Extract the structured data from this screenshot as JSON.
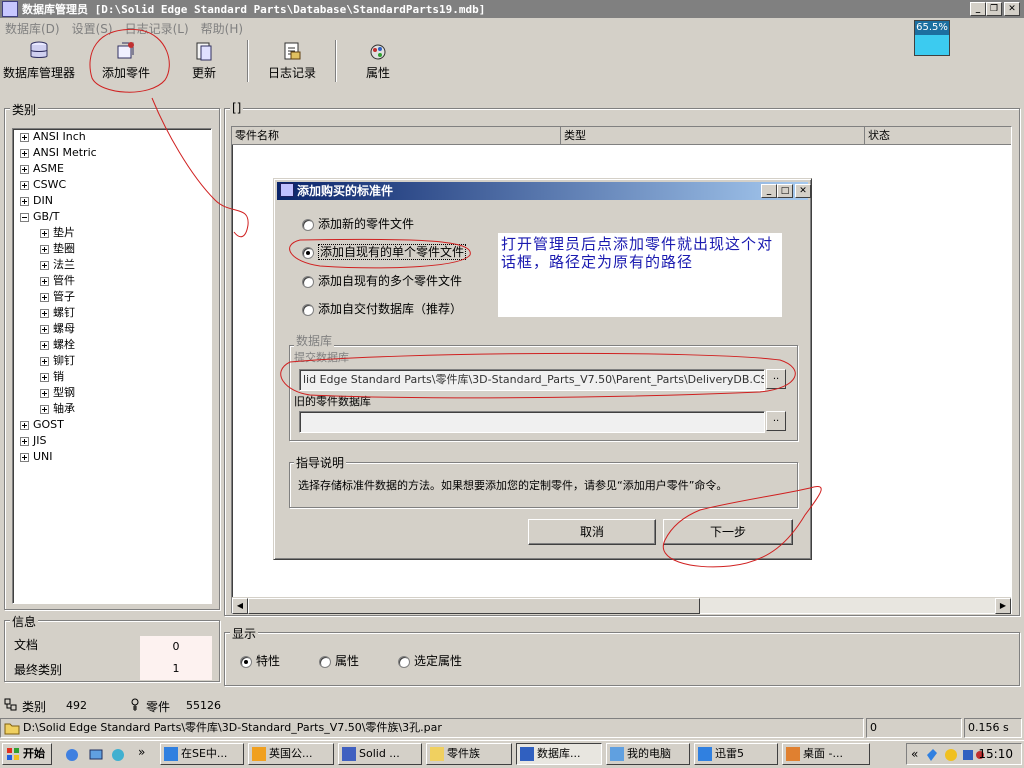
{
  "window": {
    "title": "数据库管理员 [D:\\Solid Edge Standard Parts\\Database\\StandardParts19.mdb]",
    "controls": [
      "_",
      "❐",
      "✕"
    ]
  },
  "menu": [
    "数据库(D)",
    "设置(S)",
    "日志记录(L)",
    "帮助(H)"
  ],
  "toolbar": {
    "db_manager": "数据库管理器",
    "add_part": "添加零件",
    "update": "更新",
    "log": "日志记录",
    "properties": "属性"
  },
  "progress": {
    "label": "65.5%",
    "value": 65.5
  },
  "category": {
    "label": "类别",
    "tree": [
      {
        "label": "ANSI Inch",
        "expanded": false,
        "level": 0
      },
      {
        "label": "ANSI Metric",
        "expanded": false,
        "level": 0
      },
      {
        "label": "ASME",
        "expanded": false,
        "level": 0
      },
      {
        "label": "CSWC",
        "expanded": false,
        "level": 0
      },
      {
        "label": "DIN",
        "expanded": false,
        "level": 0
      },
      {
        "label": "GB/T",
        "expanded": true,
        "level": 0
      },
      {
        "label": "垫片",
        "expanded": false,
        "level": 1
      },
      {
        "label": "垫圈",
        "expanded": false,
        "level": 1
      },
      {
        "label": "法兰",
        "expanded": false,
        "level": 1
      },
      {
        "label": "管件",
        "expanded": false,
        "level": 1
      },
      {
        "label": "管子",
        "expanded": false,
        "level": 1
      },
      {
        "label": "螺钉",
        "expanded": false,
        "level": 1
      },
      {
        "label": "螺母",
        "expanded": false,
        "level": 1
      },
      {
        "label": "螺栓",
        "expanded": false,
        "level": 1
      },
      {
        "label": "铆钉",
        "expanded": false,
        "level": 1
      },
      {
        "label": "销",
        "expanded": false,
        "level": 1
      },
      {
        "label": "型钢",
        "expanded": false,
        "level": 1
      },
      {
        "label": "轴承",
        "expanded": false,
        "level": 1
      },
      {
        "label": "GOST",
        "expanded": false,
        "level": 0
      },
      {
        "label": "JIS",
        "expanded": false,
        "level": 0
      },
      {
        "label": "UNI",
        "expanded": false,
        "level": 0
      }
    ]
  },
  "parts_list": {
    "label": "[]",
    "columns": [
      "零件名称",
      "类型",
      "状态"
    ]
  },
  "info": {
    "label": "信息",
    "doc_label": "文档",
    "doc_value": "0",
    "final_category_label": "最终类别",
    "final_category_value": "1"
  },
  "display": {
    "label": "显示",
    "options": [
      "特性",
      "属性",
      "选定属性"
    ],
    "selected": "特性"
  },
  "status": {
    "category_label": "类别",
    "category_count": "492",
    "part_label": "零件",
    "part_count": "55126",
    "path": "D:\\Solid Edge Standard Parts\\零件库\\3D-Standard_Parts_V7.50\\零件族\\3孔.par",
    "field2": "0",
    "time": "0.156 s"
  },
  "dialog": {
    "title": "添加购买的标准件",
    "options": [
      "添加新的零件文件",
      "添加自现有的单个零件文件",
      "添加自现有的多个零件文件",
      "添加自交付数据库（推荐）"
    ],
    "selected_option": "添加自现有的单个零件文件",
    "note": "打开管理员后点添加零件就出现这个对话框，路径定为原有的路径",
    "database_group": "数据库",
    "submit_db_label": "提交数据库",
    "submit_db_value": "lid Edge Standard Parts\\零件库\\3D-Standard_Parts_V7.50\\Parent_Parts\\DeliveryDB.CS.PL.ddb",
    "old_db_label": "旧的零件数据库",
    "old_db_value": "",
    "browse": "..",
    "guide_group": "指导说明",
    "guide_text": "选择存储标准件数据的方法。如果想要添加您的定制零件，请参见“添加用户零件”命令。",
    "cancel": "取消",
    "next": "下一步"
  },
  "taskbar": {
    "start": "开始",
    "quick_more": "»",
    "tasks": [
      {
        "label": "在SE中...",
        "active": false
      },
      {
        "label": "英国公...",
        "active": false
      },
      {
        "label": "Solid ...",
        "active": false
      },
      {
        "label": "零件族",
        "active": false
      },
      {
        "label": "数据库...",
        "active": true
      },
      {
        "label": "我的电脑",
        "active": false
      },
      {
        "label": "迅雷5",
        "active": false
      },
      {
        "label": "桌面 -...",
        "active": false
      }
    ],
    "tray_more": "«",
    "clock": "15:10"
  }
}
